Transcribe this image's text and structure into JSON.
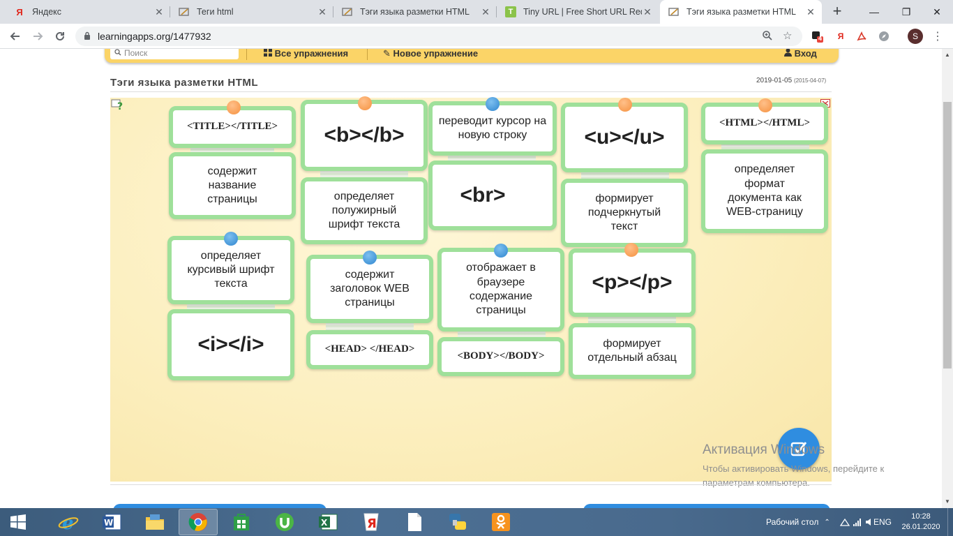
{
  "browser": {
    "tabs": [
      {
        "title": "Яндекс",
        "icon": "yandex-favicon",
        "favicon_text": "Я",
        "favicon_color": "#e0261b",
        "active": false
      },
      {
        "title": "Теги html",
        "icon": "page-favicon",
        "favicon_text": "",
        "favicon_color": "#7a7a7a",
        "active": false
      },
      {
        "title": "Тэги языка разметки HTML",
        "icon": "page-favicon",
        "favicon_text": "",
        "favicon_color": "#7a7a7a",
        "active": false
      },
      {
        "title": "Tiny URL | Free Short URL Redire",
        "icon": "tinyurl-favicon",
        "favicon_text": "T",
        "favicon_color": "#8bc34a",
        "active": false
      },
      {
        "title": "Тэги языка разметки HTML",
        "icon": "page-favicon",
        "favicon_text": "",
        "favicon_color": "#7a7a7a",
        "active": true
      }
    ],
    "new_tab_symbol": "+",
    "window_controls": {
      "minimize": "—",
      "restore": "❐",
      "close": "✕"
    },
    "url": "learningapps.org/1477932",
    "profile_initial": "S",
    "extension_badge": "4",
    "extension_yandex": "Я"
  },
  "site": {
    "search_placeholder": "Поиск",
    "menu": {
      "all_exercises": "Все упражнения",
      "new_exercise": "Новое упражнение",
      "login": "Вход"
    },
    "title": "Тэги языка разметки HTML",
    "date": "2019-01-05",
    "date_created": "(2015-04-07)"
  },
  "cards": [
    {
      "text": "<TITLE></TITLE>",
      "style": "serif",
      "pin": null
    },
    {
      "text": "содержит название страницы",
      "style": "desc",
      "pin": "orange"
    },
    {
      "text": "<b></b>",
      "style": "code",
      "pin": null
    },
    {
      "text": "определяет полужирный шрифт текста",
      "style": "desc",
      "pin": "orange"
    },
    {
      "text": "переводит курсор на новую строку",
      "style": "desc",
      "pin": null
    },
    {
      "text": "<br>",
      "style": "code",
      "pin": "blue"
    },
    {
      "text": "<u></u>",
      "style": "code",
      "pin": null
    },
    {
      "text": "формирует подчеркнутый текст",
      "style": "desc",
      "pin": "orange"
    },
    {
      "text": "<HTML></HTML>",
      "style": "serif",
      "pin": null
    },
    {
      "text": "определяет формат документа как WEB-страницу",
      "style": "desc",
      "pin": "orange"
    },
    {
      "text": "определяет курсивый шрифт текста",
      "style": "desc",
      "pin": null
    },
    {
      "text": "<i></i>",
      "style": "code",
      "pin": "blue"
    },
    {
      "text": "содержит заголовок WEB страницы",
      "style": "desc",
      "pin": null
    },
    {
      "text": "<HEAD> </HEAD>",
      "style": "serif",
      "pin": "blue"
    },
    {
      "text": "отображает в браузере содержание страницы",
      "style": "desc",
      "pin": null
    },
    {
      "text": "<BODY></BODY>",
      "style": "serif",
      "pin": "blue"
    },
    {
      "text": "<p></p>",
      "style": "code",
      "pin": null
    },
    {
      "text": "формирует отдельный абзац",
      "style": "desc",
      "pin": "orange"
    }
  ],
  "activation": {
    "title": "Активация Windows",
    "line1": "Чтобы активировать Windows, перейдите к",
    "line2": "параметрам компьютера."
  },
  "taskbar": {
    "apps": [
      "start-button",
      "internet-explorer",
      "word",
      "file-explorer",
      "chrome",
      "store",
      "utorrent",
      "excel",
      "yandex-browser",
      "notepad",
      "python",
      "odnoklassniki"
    ],
    "desktop_label": "Рабочий стол",
    "language": "ENG",
    "time": "10:28",
    "date": "26.01.2020"
  },
  "colors": {
    "card_border": "#9fe09a",
    "pin_orange": "#f5913f",
    "pin_blue": "#2f86cf",
    "site_bar": "#fbd467",
    "check_button": "#2f8de0"
  }
}
